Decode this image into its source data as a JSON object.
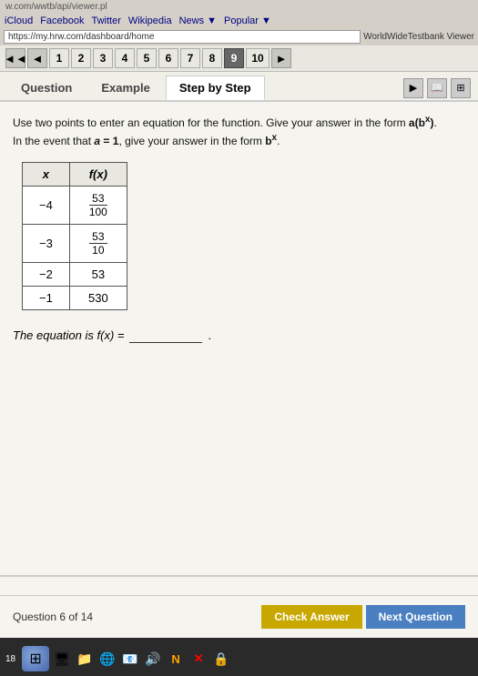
{
  "browser": {
    "top_url": "w.com/wwtb/api/viewer.pl",
    "nav_links": [
      "iCloud",
      "Facebook",
      "Twitter",
      "Wikipedia",
      "News ▼",
      "Popular ▼"
    ],
    "address_url": "https://my.hrw.com/dashboard/home",
    "worldwidetestbank_label": "WorldWideTestbank Viewer"
  },
  "page_nav": {
    "left_arrow": "◄◄",
    "left_single_arrow": "◄",
    "pages": [
      "1",
      "2",
      "3",
      "4",
      "5",
      "6",
      "7",
      "8",
      "9",
      "10"
    ],
    "active_page": "9",
    "right_arrow": "►"
  },
  "tabs": {
    "items": [
      "Question",
      "Example",
      "Step by Step"
    ],
    "active": "Step by Step"
  },
  "content": {
    "instructions_line1": "Use two points to enter an equation for the function. Give your answer in the form a(b",
    "instructions_line2": "In the event that a = 1, give your answer in the form b",
    "table": {
      "col_x": "x",
      "col_fx": "f(x)",
      "rows": [
        {
          "x": "-4",
          "fx_num": "53",
          "fx_den": "100",
          "is_fraction": true
        },
        {
          "x": "-3",
          "fx_num": "53",
          "fx_den": "10",
          "is_fraction": true
        },
        {
          "x": "-2",
          "fx_plain": "53",
          "is_fraction": false
        },
        {
          "x": "-1",
          "fx_plain": "530",
          "is_fraction": false
        }
      ]
    },
    "equation_label": "The equation is f(x) =",
    "equation_input_placeholder": ""
  },
  "footer": {
    "question_count": "Question 6 of 14",
    "check_answer_btn": "Check Answer",
    "next_question_btn": "Next Question"
  },
  "taskbar": {
    "time": "18",
    "icons": [
      "🖥",
      "📁",
      "🌐",
      "📧",
      "🔊",
      "🔒"
    ]
  }
}
